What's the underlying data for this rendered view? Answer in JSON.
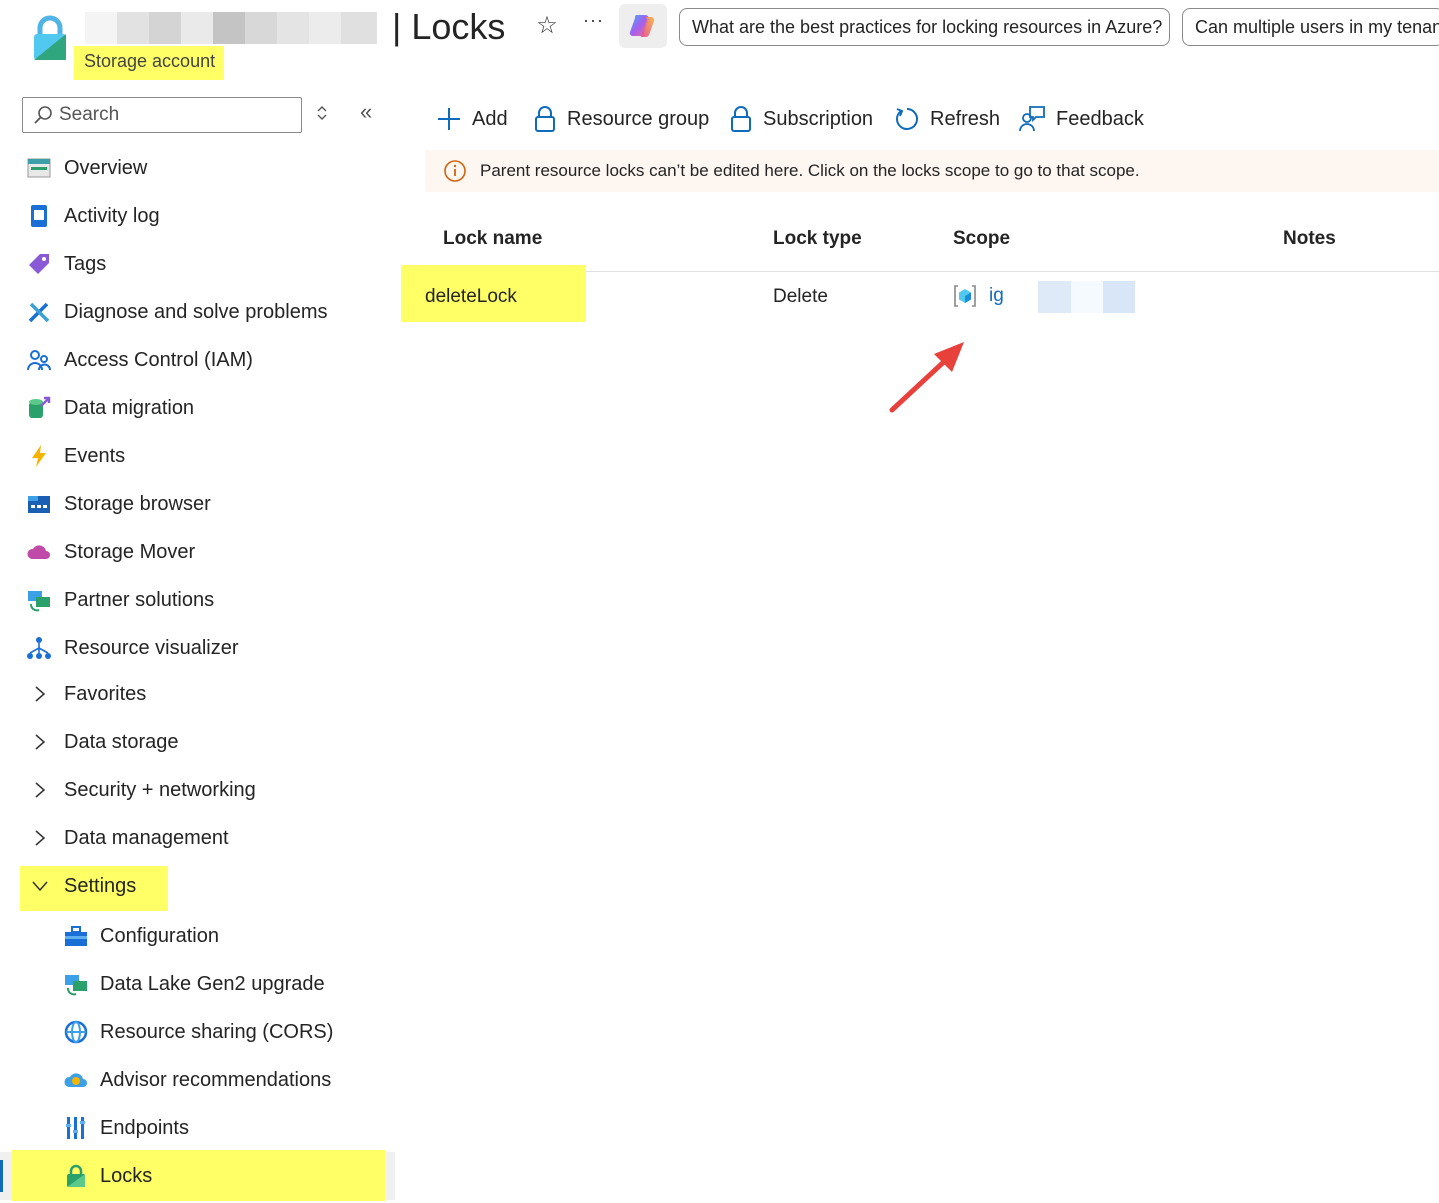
{
  "header": {
    "title": "| Locks",
    "subtitle": "Storage account",
    "copilot_prompts": [
      "What are the best practices for locking resources in Azure?",
      "Can multiple users in my tenan"
    ]
  },
  "sidebar": {
    "search_placeholder": "Search",
    "items": [
      {
        "label": "Overview",
        "icon": "overview-icon"
      },
      {
        "label": "Activity log",
        "icon": "activity-log-icon"
      },
      {
        "label": "Tags",
        "icon": "tag-icon"
      },
      {
        "label": "Diagnose and solve problems",
        "icon": "wrench-icon"
      },
      {
        "label": "Access Control (IAM)",
        "icon": "people-icon"
      },
      {
        "label": "Data migration",
        "icon": "data-migration-icon"
      },
      {
        "label": "Events",
        "icon": "lightning-icon"
      },
      {
        "label": "Storage browser",
        "icon": "storage-browser-icon"
      },
      {
        "label": "Storage Mover",
        "icon": "cloud-icon"
      },
      {
        "label": "Partner solutions",
        "icon": "partner-icon"
      },
      {
        "label": "Resource visualizer",
        "icon": "hierarchy-icon"
      }
    ],
    "groups": [
      {
        "label": "Favorites",
        "expanded": false
      },
      {
        "label": "Data storage",
        "expanded": false
      },
      {
        "label": "Security + networking",
        "expanded": false
      },
      {
        "label": "Data management",
        "expanded": false
      },
      {
        "label": "Settings",
        "expanded": true
      }
    ],
    "settings_items": [
      {
        "label": "Configuration",
        "icon": "toolbox-icon"
      },
      {
        "label": "Data Lake Gen2 upgrade",
        "icon": "upgrade-icon"
      },
      {
        "label": "Resource sharing (CORS)",
        "icon": "cors-icon"
      },
      {
        "label": "Advisor recommendations",
        "icon": "advisor-icon"
      },
      {
        "label": "Endpoints",
        "icon": "endpoints-icon"
      },
      {
        "label": "Locks",
        "icon": "lock-icon",
        "selected": true
      }
    ]
  },
  "toolbar": {
    "add": "Add",
    "resource_group": "Resource group",
    "subscription": "Subscription",
    "refresh": "Refresh",
    "feedback": "Feedback"
  },
  "info_message": "Parent resource locks can’t be edited here. Click on the locks scope to go to that scope.",
  "table": {
    "columns": [
      "Lock name",
      "Lock type",
      "Scope",
      "Notes"
    ],
    "rows": [
      {
        "lock_name": "deleteLock",
        "lock_type": "Delete",
        "scope": "ig",
        "notes": ""
      }
    ]
  },
  "colors": {
    "highlight": "#ffff66",
    "link": "#0f6cbd",
    "annotation_arrow": "#e8403a"
  }
}
